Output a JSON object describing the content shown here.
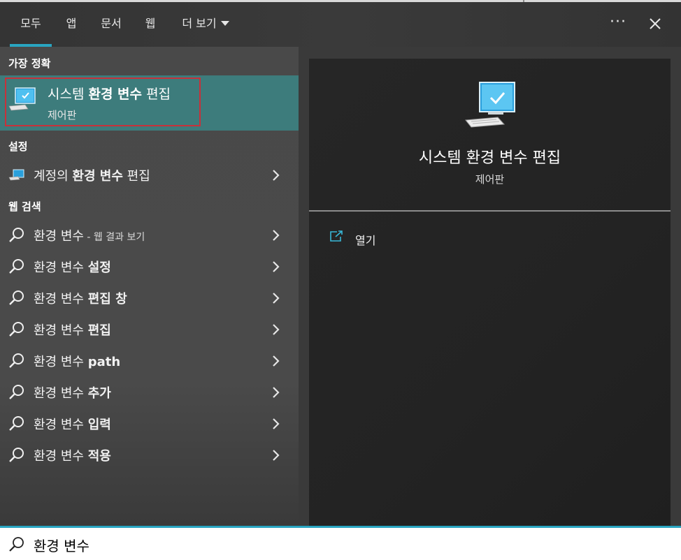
{
  "tabs": [
    {
      "label": "모두",
      "active": true
    },
    {
      "label": "앱"
    },
    {
      "label": "문서"
    },
    {
      "label": "웹"
    },
    {
      "label": "더 보기"
    }
  ],
  "best_match": {
    "header": "가장 정확",
    "title_prefix": "시스템 ",
    "title_bold": "환경 변수",
    "title_suffix": " 편집",
    "subtitle": "제어판"
  },
  "settings": {
    "header": "설정",
    "item": {
      "prefix": "계정의 ",
      "bold": "환경 변수",
      "suffix": " 편집"
    }
  },
  "web": {
    "header": "웹 검색",
    "items": [
      {
        "text": "환경 변수",
        "extra": " - 웹 결과 보기"
      },
      {
        "text": "환경 변수 ",
        "bold": "설정"
      },
      {
        "text": "환경 변수 ",
        "bold": "편집 창"
      },
      {
        "text": "환경 변수 ",
        "bold": "편집"
      },
      {
        "text": "환경 변수 ",
        "bold": "path"
      },
      {
        "text": "환경 변수 ",
        "bold": "추가"
      },
      {
        "text": "환경 변수 ",
        "bold": "입력"
      },
      {
        "text": "환경 변수 ",
        "bold": "적용"
      }
    ]
  },
  "preview": {
    "title": "시스템 환경 변수 편집",
    "subtitle": "제어판",
    "action_open": "열기"
  },
  "search": {
    "value": "환경 변수"
  },
  "colors": {
    "accent": "#29a5c1",
    "selected_bg": "#3d7c7c",
    "highlight_frame": "#c8313a"
  },
  "icons": {
    "more": "ellipsis-icon",
    "close": "close-icon",
    "search": "search-icon",
    "open": "open-external-icon"
  }
}
